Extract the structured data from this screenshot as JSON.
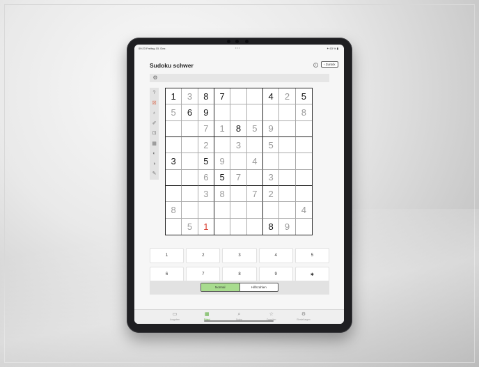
{
  "status_bar": {
    "time": "09:23 Freitag 15. Dez.",
    "dots": "•••",
    "right": "✦ 63 % ▮"
  },
  "header": {
    "title": "Sudoku schwer",
    "back_label": "‹ Zurück",
    "info_icon": "info-icon"
  },
  "toolbar": {
    "settings_icon": "gear-icon"
  },
  "tools": [
    {
      "icon": "help-icon",
      "glyph": "?"
    },
    {
      "icon": "error-check-icon",
      "glyph": "☒",
      "color": "#d85a3c"
    },
    {
      "icon": "hint-bulb-icon",
      "glyph": "♁"
    },
    {
      "icon": "eraser-icon",
      "glyph": "✐"
    },
    {
      "icon": "delete-icon",
      "glyph": "⊡"
    },
    {
      "icon": "keyboard-icon",
      "glyph": "▦"
    },
    {
      "icon": "undo-icon",
      "glyph": "◐"
    },
    {
      "icon": "redo-icon",
      "glyph": "◑"
    },
    {
      "icon": "pen-icon",
      "glyph": "✎"
    }
  ],
  "board": [
    [
      {
        "v": "1",
        "t": "g"
      },
      {
        "v": "3",
        "t": "e"
      },
      {
        "v": "8",
        "t": "g"
      },
      {
        "v": "7",
        "t": "g"
      },
      {
        "v": "",
        "t": ""
      },
      {
        "v": "",
        "t": ""
      },
      {
        "v": "4",
        "t": "g"
      },
      {
        "v": "2",
        "t": "e"
      },
      {
        "v": "5",
        "t": "g"
      }
    ],
    [
      {
        "v": "5",
        "t": "e"
      },
      {
        "v": "6",
        "t": "g"
      },
      {
        "v": "9",
        "t": "g"
      },
      {
        "v": "",
        "t": ""
      },
      {
        "v": "",
        "t": ""
      },
      {
        "v": "",
        "t": ""
      },
      {
        "v": "",
        "t": ""
      },
      {
        "v": "",
        "t": ""
      },
      {
        "v": "8",
        "t": "e"
      }
    ],
    [
      {
        "v": "",
        "t": ""
      },
      {
        "v": "",
        "t": ""
      },
      {
        "v": "7",
        "t": "e"
      },
      {
        "v": "1",
        "t": "e"
      },
      {
        "v": "8",
        "t": "g"
      },
      {
        "v": "5",
        "t": "e"
      },
      {
        "v": "9",
        "t": "e"
      },
      {
        "v": "",
        "t": ""
      },
      {
        "v": "",
        "t": ""
      }
    ],
    [
      {
        "v": "",
        "t": ""
      },
      {
        "v": "",
        "t": ""
      },
      {
        "v": "2",
        "t": "e"
      },
      {
        "v": "",
        "t": ""
      },
      {
        "v": "3",
        "t": "e"
      },
      {
        "v": "",
        "t": ""
      },
      {
        "v": "5",
        "t": "e"
      },
      {
        "v": "",
        "t": ""
      },
      {
        "v": "",
        "t": ""
      }
    ],
    [
      {
        "v": "3",
        "t": "g"
      },
      {
        "v": "",
        "t": ""
      },
      {
        "v": "5",
        "t": "g"
      },
      {
        "v": "9",
        "t": "e"
      },
      {
        "v": "",
        "t": ""
      },
      {
        "v": "4",
        "t": "e"
      },
      {
        "v": "",
        "t": ""
      },
      {
        "v": "",
        "t": ""
      },
      {
        "v": "",
        "t": ""
      }
    ],
    [
      {
        "v": "",
        "t": ""
      },
      {
        "v": "",
        "t": ""
      },
      {
        "v": "6",
        "t": "e"
      },
      {
        "v": "5",
        "t": "g"
      },
      {
        "v": "7",
        "t": "e"
      },
      {
        "v": "",
        "t": ""
      },
      {
        "v": "3",
        "t": "e"
      },
      {
        "v": "",
        "t": ""
      },
      {
        "v": "",
        "t": ""
      }
    ],
    [
      {
        "v": "",
        "t": ""
      },
      {
        "v": "",
        "t": ""
      },
      {
        "v": "3",
        "t": "e"
      },
      {
        "v": "8",
        "t": "e"
      },
      {
        "v": "",
        "t": ""
      },
      {
        "v": "7",
        "t": "e"
      },
      {
        "v": "2",
        "t": "e"
      },
      {
        "v": "",
        "t": ""
      },
      {
        "v": "",
        "t": ""
      }
    ],
    [
      {
        "v": "8",
        "t": "e"
      },
      {
        "v": "",
        "t": ""
      },
      {
        "v": "",
        "t": ""
      },
      {
        "v": "",
        "t": ""
      },
      {
        "v": "",
        "t": ""
      },
      {
        "v": "",
        "t": ""
      },
      {
        "v": "",
        "t": ""
      },
      {
        "v": "",
        "t": ""
      },
      {
        "v": "4",
        "t": "e"
      }
    ],
    [
      {
        "v": "",
        "t": ""
      },
      {
        "v": "5",
        "t": "e"
      },
      {
        "v": "1",
        "t": "x"
      },
      {
        "v": "",
        "t": ""
      },
      {
        "v": "",
        "t": ""
      },
      {
        "v": "",
        "t": ""
      },
      {
        "v": "8",
        "t": "g"
      },
      {
        "v": "9",
        "t": "e"
      },
      {
        "v": "",
        "t": ""
      }
    ]
  ],
  "numpad": [
    "1",
    "2",
    "3",
    "4",
    "5",
    "6",
    "7",
    "8",
    "9",
    "✱"
  ],
  "mode": {
    "options": [
      "Normal",
      "Hilfszahlen"
    ],
    "selected": "Normal",
    "selected_color": "#a8dc8e"
  },
  "tabbar": [
    {
      "label": "Ausgaben",
      "icon": "calendar-icon",
      "glyph": "▭",
      "active": false
    },
    {
      "label": "Rätsel",
      "icon": "puzzle-grid-icon",
      "glyph": "▦",
      "active": true
    },
    {
      "label": "Suche",
      "icon": "search-icon",
      "glyph": "⌕",
      "active": false
    },
    {
      "label": "Favoriten",
      "icon": "favorites-icon",
      "glyph": "☆",
      "active": false
    },
    {
      "label": "Einstellungen",
      "icon": "settings-icon",
      "glyph": "⚙",
      "active": false
    }
  ],
  "colors": {
    "error": "#d83b2e",
    "accent": "#5cae3c",
    "given": "#111111",
    "entered": "#9a9a9a"
  }
}
